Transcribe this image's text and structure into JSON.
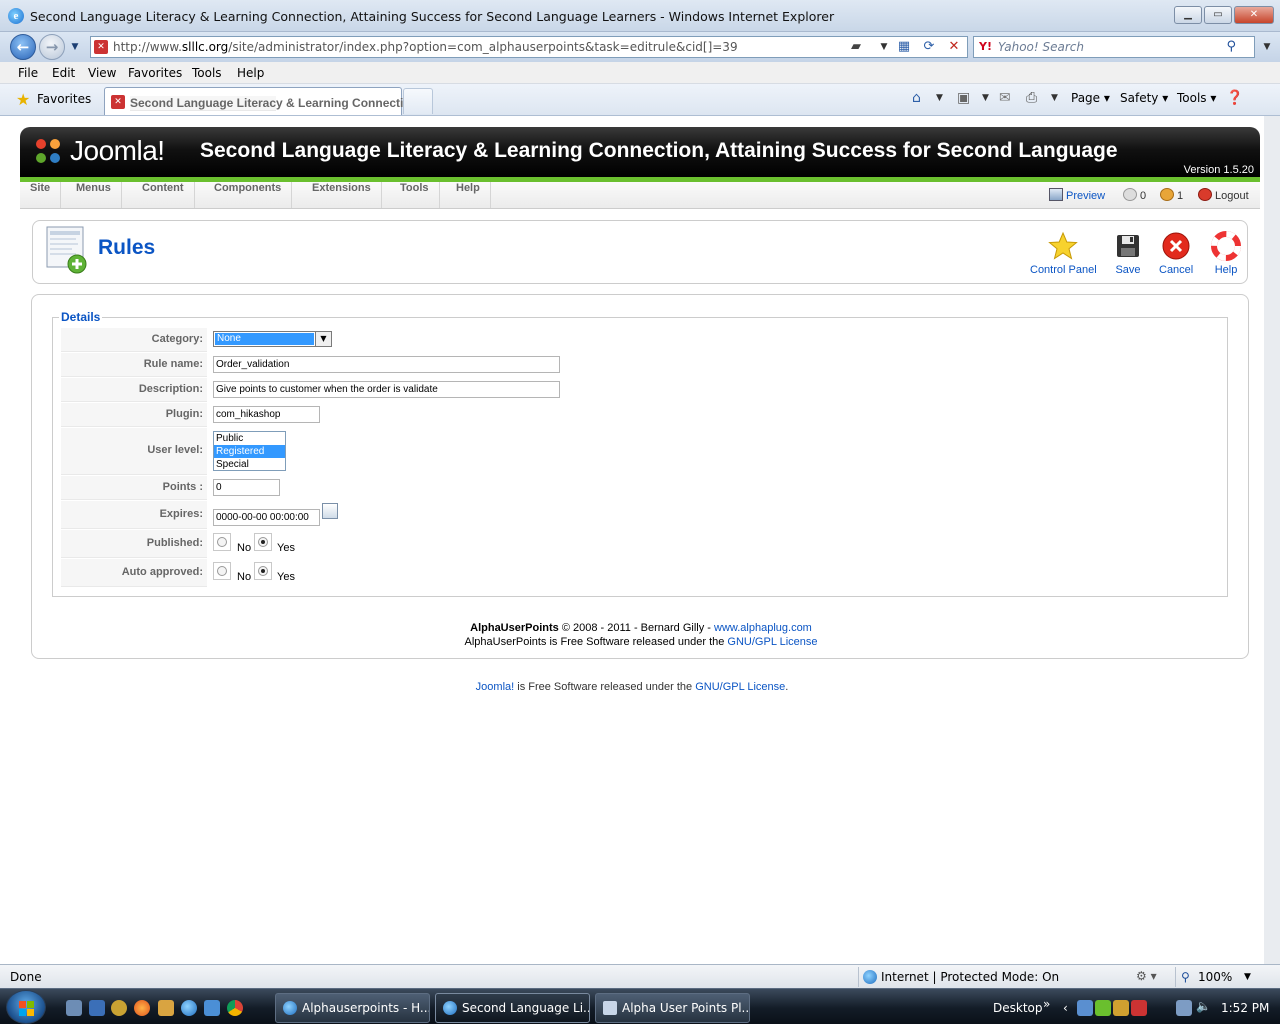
{
  "window": {
    "title": "Second Language Literacy & Learning Connection, Attaining Success for Second Language Learners  - Windows Internet Explorer"
  },
  "address": {
    "url_prefix": "http://www.",
    "url_domain": "slllc.org",
    "url_rest": "/site/administrator/index.php?option=com_alphauserpoints&task=editrule&cid[]=39",
    "search_placeholder": "Yahoo! Search",
    "search_logo": "Y!"
  },
  "menubar": [
    "File",
    "Edit",
    "View",
    "Favorites",
    "Tools",
    "Help"
  ],
  "favbar": {
    "favorites_label": "Favorites",
    "tab_title": "Second Language Literacy & Learning Connectio...",
    "commands": [
      "Page",
      "Safety",
      "Tools"
    ]
  },
  "joomla": {
    "logo_text": "Joomla!",
    "site_title": "Second Language Literacy & Learning Connection, Attaining Success for Second Language",
    "version": "Version 1.5.20",
    "menu": [
      "Site",
      "Menus",
      "Content",
      "Components",
      "Extensions",
      "Tools",
      "Help"
    ],
    "status": {
      "preview": "Preview",
      "messages": "0",
      "users": "1",
      "logout": "Logout"
    }
  },
  "toolbar": {
    "title": "Rules",
    "buttons": [
      {
        "label": "Control Panel",
        "icon": "star-icon"
      },
      {
        "label": "Save",
        "icon": "floppy-icon"
      },
      {
        "label": "Cancel",
        "icon": "cancel-icon"
      },
      {
        "label": "Help",
        "icon": "lifebuoy-icon"
      }
    ]
  },
  "form": {
    "legend": "Details",
    "category": {
      "label": "Category:",
      "value": "None"
    },
    "rule_name": {
      "label": "Rule name:",
      "value": "Order_validation"
    },
    "description": {
      "label": "Description:",
      "value": "Give points to customer when the order is validate"
    },
    "plugin": {
      "label": "Plugin:",
      "value": "com_hikashop"
    },
    "user_level": {
      "label": "User level:",
      "options": [
        "Public",
        "Registered",
        "Special"
      ],
      "selected": "Registered"
    },
    "points": {
      "label": "Points :",
      "value": "0"
    },
    "expires": {
      "label": "Expires:",
      "value": "0000-00-00 00:00:00"
    },
    "published": {
      "label": "Published:",
      "no": "No",
      "yes": "Yes",
      "selected": "Yes"
    },
    "auto_approved": {
      "label": "Auto approved:",
      "no": "No",
      "yes": "Yes",
      "selected": "Yes"
    }
  },
  "credits": {
    "product": "AlphaUserPoints",
    "line1_rest": " © 2008 - 2011 - Bernard Gilly - ",
    "site_link": "www.alphaplug.com",
    "line2_text": "AlphaUserPoints is Free Software released under the ",
    "license_link": "GNU/GPL License"
  },
  "footer": {
    "joomla_link": "Joomla!",
    "text": " is Free Software released under the ",
    "license_link": "GNU/GPL License",
    "period": "."
  },
  "statusbar": {
    "status": "Done",
    "zone": "Internet | Protected Mode: On",
    "zoom": "100%"
  },
  "taskbar": {
    "tasks": [
      "Alphauserpoints - H...",
      "Second Language Li...",
      "Alpha User Points Pl..."
    ],
    "desktop_label": "Desktop",
    "time": "1:52 PM"
  },
  "colors": {
    "joomla_blue": "#0b55c4",
    "joomla_green": "#6abf2e",
    "selection": "#3399ff"
  }
}
